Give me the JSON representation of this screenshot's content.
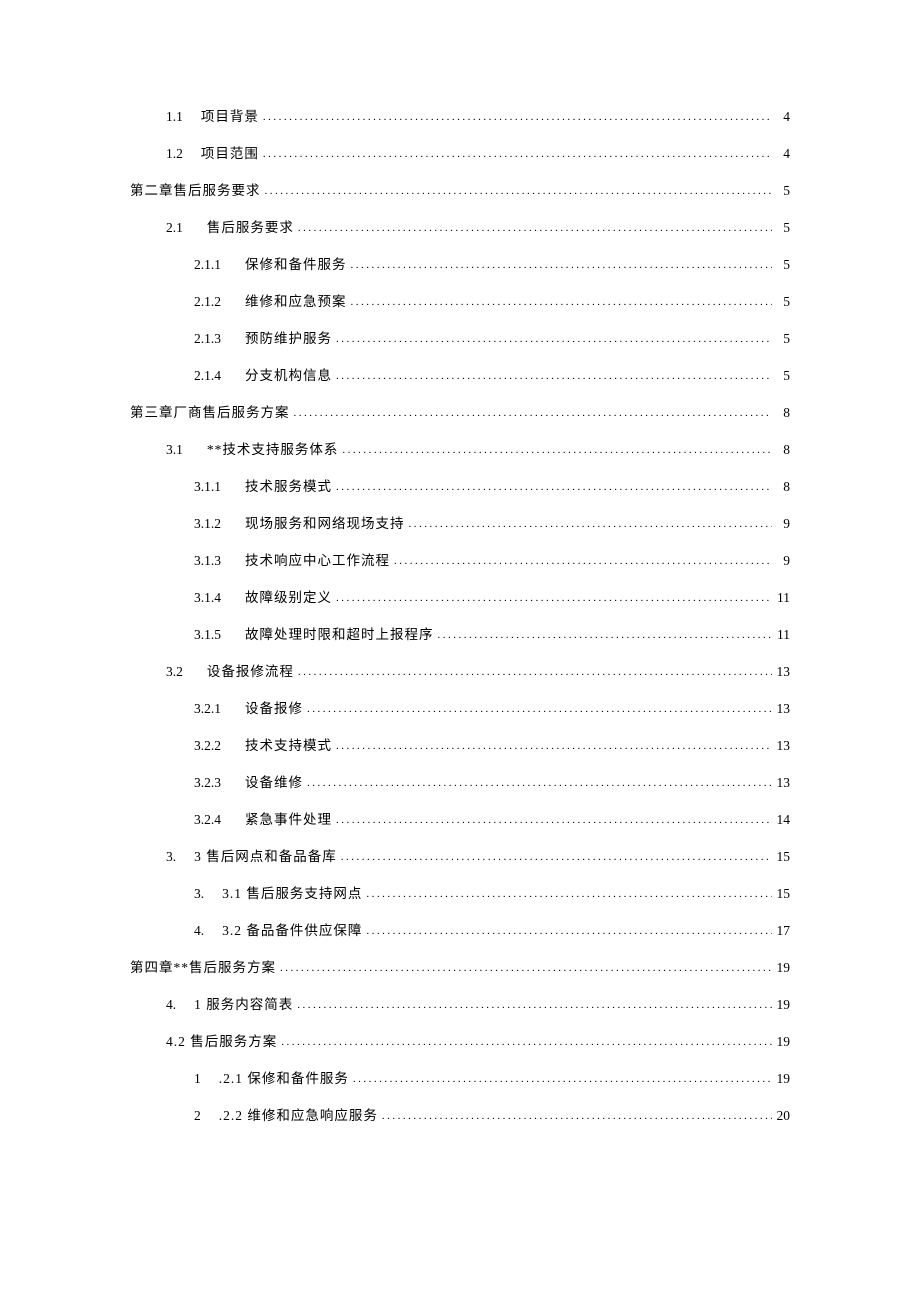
{
  "entries": [
    {
      "indent": 1,
      "num": "1.1",
      "title": "项目背景",
      "page": "4",
      "numClass": "num"
    },
    {
      "indent": 1,
      "num": "1.2",
      "title": "项目范围",
      "page": "4",
      "numClass": "num"
    },
    {
      "indent": 0,
      "num": "",
      "title": "第二章售后服务要求",
      "page": "5",
      "numClass": ""
    },
    {
      "indent": 1,
      "num": "2.1",
      "title": "售后服务要求",
      "page": "5",
      "numClass": "num num-wide"
    },
    {
      "indent": 2,
      "num": "2.1.1",
      "title": "保修和备件服务",
      "page": "5",
      "numClass": "num num-wide"
    },
    {
      "indent": 2,
      "num": "2.1.2",
      "title": "维修和应急预案",
      "page": "5",
      "numClass": "num num-wide"
    },
    {
      "indent": 2,
      "num": "2.1.3",
      "title": "预防维护服务",
      "page": "5",
      "numClass": "num num-wide"
    },
    {
      "indent": 2,
      "num": "2.1.4",
      "title": "分支机构信息",
      "page": "5",
      "numClass": "num num-wide"
    },
    {
      "indent": 0,
      "num": "",
      "title": "第三章厂商售后服务方案",
      "page": "8",
      "numClass": ""
    },
    {
      "indent": 1,
      "num": "3.1",
      "title": "**技术支持服务体系",
      "page": "8",
      "numClass": "num num-wide"
    },
    {
      "indent": 2,
      "num": "3.1.1",
      "title": "技术服务模式",
      "page": "8",
      "numClass": "num num-wide"
    },
    {
      "indent": 2,
      "num": "3.1.2",
      "title": "现场服务和网络现场支持",
      "page": "9",
      "numClass": "num num-wide"
    },
    {
      "indent": 2,
      "num": "3.1.3",
      "title": "技术响应中心工作流程",
      "page": "9",
      "numClass": "num num-wide"
    },
    {
      "indent": 2,
      "num": "3.1.4",
      "title": "故障级别定义",
      "page": "11",
      "numClass": "num num-wide"
    },
    {
      "indent": 2,
      "num": "3.1.5",
      "title": "故障处理时限和超时上报程序",
      "page": "11",
      "numClass": "num num-wide"
    },
    {
      "indent": 1,
      "num": "3.2",
      "title": "设备报修流程",
      "page": "13",
      "numClass": "num num-wide"
    },
    {
      "indent": 2,
      "num": "3.2.1",
      "title": "设备报修",
      "page": "13",
      "numClass": "num num-wide"
    },
    {
      "indent": 2,
      "num": "3.2.2",
      "title": "技术支持模式",
      "page": "13",
      "numClass": "num num-wide"
    },
    {
      "indent": 2,
      "num": "3.2.3",
      "title": "设备维修",
      "page": "13",
      "numClass": "num num-wide"
    },
    {
      "indent": 2,
      "num": "3.2.4",
      "title": "紧急事件处理",
      "page": "14",
      "numClass": "num num-wide"
    },
    {
      "indent": 1,
      "num": "3.",
      "title": "3 售后网点和备品备库",
      "page": "15",
      "numClass": "num"
    },
    {
      "indent": 2,
      "num": "3.",
      "title": "3.1 售后服务支持网点",
      "page": "15",
      "numClass": "num"
    },
    {
      "indent": 2,
      "num": "4.",
      "title": "3.2 备品备件供应保障",
      "page": "17",
      "numClass": "num"
    },
    {
      "indent": 0,
      "num": "",
      "title": "第四章**售后服务方案",
      "page": "19",
      "numClass": ""
    },
    {
      "indent": 1,
      "num": "4.",
      "title": "1 服务内容简表",
      "page": "19",
      "numClass": "num"
    },
    {
      "indent": 1,
      "num": "",
      "title": "4.2 售后服务方案",
      "page": "19",
      "numClass": ""
    },
    {
      "indent": 2,
      "num": "1",
      "title": ".2.1 保修和备件服务",
      "page": "19",
      "numClass": "num"
    },
    {
      "indent": 2,
      "num": "2",
      "title": ".2.2 维修和应急响应服务",
      "page": "20",
      "numClass": "num"
    }
  ]
}
